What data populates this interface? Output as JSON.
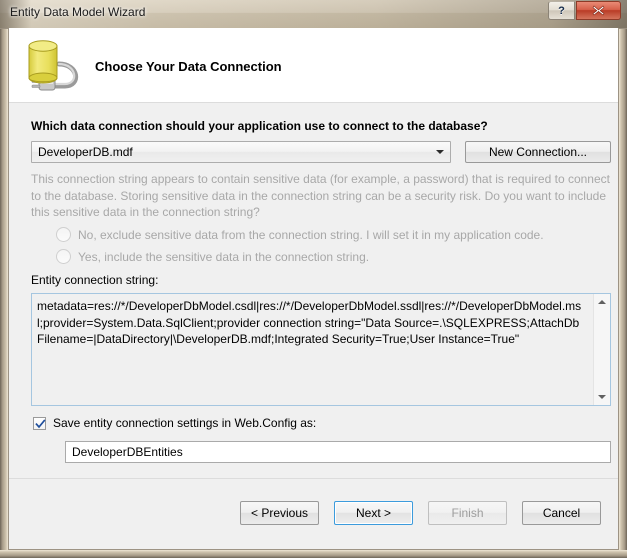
{
  "window": {
    "title": "Entity Data Model Wizard",
    "help_button": "?",
    "close_button": "✕"
  },
  "banner": {
    "icon": "database-connection-icon",
    "title": "Choose Your Data Connection"
  },
  "main": {
    "question_label": "Which data connection should your application use to connect to the database?",
    "connection_combo": {
      "value": "DeveloperDB.mdf",
      "arrow_icon": "chevron-down-icon"
    },
    "new_connection_button": "New Connection...",
    "sensitive_note": "This connection string appears to contain sensitive data (for example, a password) that is required to connect to the database. Storing sensitive data in the connection string can be a security risk. Do you want to include this sensitive data in the connection string?",
    "radios": [
      {
        "label": "No, exclude sensitive data from the connection string. I will set it in my application code.",
        "selected": false,
        "disabled": true
      },
      {
        "label": "Yes, include the sensitive data in the connection string.",
        "selected": false,
        "disabled": true
      }
    ],
    "entity_connection_label": "Entity connection string:",
    "entity_connection_value": "metadata=res://*/DeveloperDbModel.csdl|res://*/DeveloperDbModel.ssdl|res://*/DeveloperDbModel.msl;provider=System.Data.SqlClient;provider connection string=\"Data Source=.\\SQLEXPRESS;AttachDbFilename=|DataDirectory|\\DeveloperDB.mdf;Integrated Security=True;User Instance=True\"",
    "save_checkbox": {
      "label": "Save entity connection settings in Web.Config as:",
      "checked": true
    },
    "entities_name_value": "DeveloperDBEntities"
  },
  "footer": {
    "previous_button": "< Previous",
    "next_button": "Next >",
    "finish_button": "Finish",
    "cancel_button": "Cancel"
  },
  "colors": {
    "accent_blue": "#3c9bdc",
    "close_red": "#b93c26",
    "disabled_text": "#a8a8a8",
    "db_icon_yellow": "#e8e05a"
  }
}
